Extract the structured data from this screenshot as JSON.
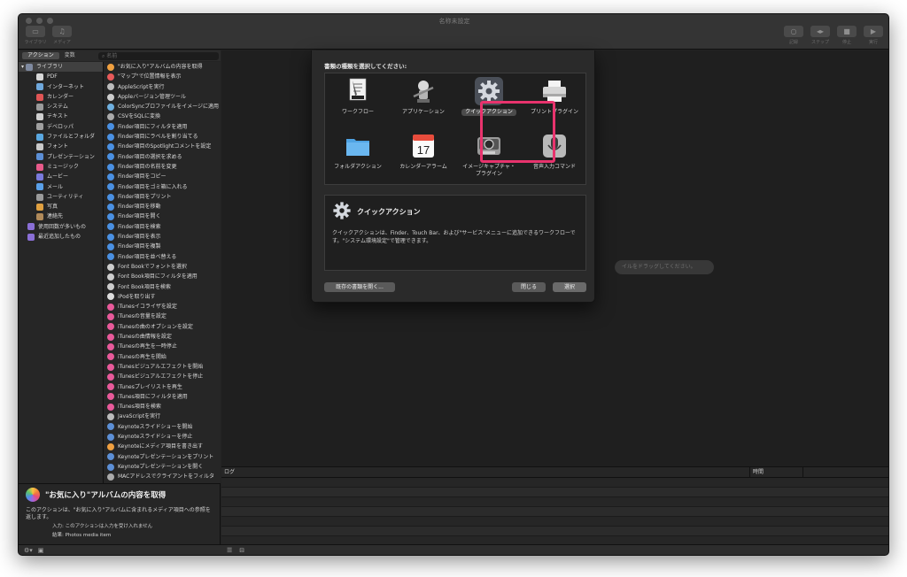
{
  "window": {
    "title": "名称未設定"
  },
  "toolbar": {
    "left_buttons": [
      {
        "label": "ライブラリ"
      },
      {
        "label": "メディア"
      }
    ],
    "right_buttons": [
      {
        "label": "記録"
      },
      {
        "label": "ステップ"
      },
      {
        "label": "停止"
      },
      {
        "label": "実行"
      }
    ]
  },
  "tabs": [
    {
      "label": "アクション"
    },
    {
      "label": "変数"
    }
  ],
  "search": {
    "placeholder": "名前"
  },
  "library": [
    {
      "label": "ライブラリ",
      "color": "#7f8aa0"
    },
    {
      "label": "PDF",
      "color": "#d7d7d7"
    },
    {
      "label": "インターネット",
      "color": "#6fa8dc"
    },
    {
      "label": "カレンダー",
      "color": "#e05555"
    },
    {
      "label": "システム",
      "color": "#9a9a9a"
    },
    {
      "label": "テキスト",
      "color": "#d0d0d0"
    },
    {
      "label": "デベロッパ",
      "color": "#a0a0a0"
    },
    {
      "label": "ファイルとフォルダ",
      "color": "#5aa7e0"
    },
    {
      "label": "フォント",
      "color": "#c9c9c9"
    },
    {
      "label": "プレゼンテーション",
      "color": "#5c8fd6"
    },
    {
      "label": "ミュージック",
      "color": "#e85a8a"
    },
    {
      "label": "ムービー",
      "color": "#7a7adc"
    },
    {
      "label": "メール",
      "color": "#5aa0e8"
    },
    {
      "label": "ユーティリティ",
      "color": "#9a9a9a"
    },
    {
      "label": "写真",
      "color": "#e0a040"
    },
    {
      "label": "連絡先",
      "color": "#b08a5a"
    },
    {
      "label": "使用回数が多いもの",
      "color": "#8a6fd6"
    },
    {
      "label": "最近追加したもの",
      "color": "#8a6fd6"
    }
  ],
  "actions": [
    {
      "label": "\"お気に入り\"アルバムの内容を取得",
      "color": "#f0a040"
    },
    {
      "label": "\"マップ\"で位置情報を表示",
      "color": "#e85a5a"
    },
    {
      "label": "AppleScriptを実行",
      "color": "#bbbbbb"
    },
    {
      "label": "Appleバージョン管理ツール",
      "color": "#cccccc"
    },
    {
      "label": "ColorSyncプロファイルをイメージに適用",
      "color": "#6fb0e0"
    },
    {
      "label": "CSVをSQLに変換",
      "color": "#aaaaaa"
    },
    {
      "label": "Finder項目にフィルタを適用",
      "color": "#4a90e2"
    },
    {
      "label": "Finder項目にラベルを割り当てる",
      "color": "#4a90e2"
    },
    {
      "label": "Finder項目のSpotlightコメントを設定",
      "color": "#4a90e2"
    },
    {
      "label": "Finder項目の選択を求める",
      "color": "#4a90e2"
    },
    {
      "label": "Finder項目の名前を変更",
      "color": "#4a90e2"
    },
    {
      "label": "Finder項目をコピー",
      "color": "#4a90e2"
    },
    {
      "label": "Finder項目をゴミ箱に入れる",
      "color": "#4a90e2"
    },
    {
      "label": "Finder項目をプリント",
      "color": "#4a90e2"
    },
    {
      "label": "Finder項目を移動",
      "color": "#4a90e2"
    },
    {
      "label": "Finder項目を開く",
      "color": "#4a90e2"
    },
    {
      "label": "Finder項目を検索",
      "color": "#4a90e2"
    },
    {
      "label": "Finder項目を表示",
      "color": "#4a90e2"
    },
    {
      "label": "Finder項目を複製",
      "color": "#4a90e2"
    },
    {
      "label": "Finder項目を並べ替える",
      "color": "#4a90e2"
    },
    {
      "label": "Font Bookでフォントを選択",
      "color": "#cccccc"
    },
    {
      "label": "Font Book項目にフィルタを適用",
      "color": "#cccccc"
    },
    {
      "label": "Font Book項目を検索",
      "color": "#cccccc"
    },
    {
      "label": "iPodを取り出す",
      "color": "#dddddd"
    },
    {
      "label": "iTunesイコライザを設定",
      "color": "#e85a9a"
    },
    {
      "label": "iTunesの音量を設定",
      "color": "#e85a9a"
    },
    {
      "label": "iTunesの曲のオプションを設定",
      "color": "#e85a9a"
    },
    {
      "label": "iTunesの曲情報を設定",
      "color": "#e85a9a"
    },
    {
      "label": "iTunesの再生を一時停止",
      "color": "#e85a9a"
    },
    {
      "label": "iTunesの再生を開始",
      "color": "#e85a9a"
    },
    {
      "label": "iTunesビジュアルエフェクトを開始",
      "color": "#e85a9a"
    },
    {
      "label": "iTunesビジュアルエフェクトを停止",
      "color": "#e85a9a"
    },
    {
      "label": "iTunesプレイリストを再生",
      "color": "#e85a9a"
    },
    {
      "label": "iTunes項目にフィルタを適用",
      "color": "#e85a9a"
    },
    {
      "label": "iTunes項目を検索",
      "color": "#e85a9a"
    },
    {
      "label": "JavaScriptを実行",
      "color": "#bbbbbb"
    },
    {
      "label": "Keynoteスライドショーを開始",
      "color": "#5c8fd6"
    },
    {
      "label": "Keynoteスライドショーを停止",
      "color": "#5c8fd6"
    },
    {
      "label": "Keynoteにメディア項目を書き出す",
      "color": "#f0a040"
    },
    {
      "label": "Keynoteプレゼンテーションをプリント",
      "color": "#5c8fd6"
    },
    {
      "label": "Keynoteプレゼンテーションを開く",
      "color": "#5c8fd6"
    },
    {
      "label": "MACアドレスでクライアントをフィルタ",
      "color": "#aaaaaa"
    }
  ],
  "description": {
    "title": "\"お気に入り\"アルバムの内容を取得",
    "body": "このアクションは、\"お気に入り\"アルバムに含まれるメディア項目への参照を返します。",
    "input": "入力: このアクションは入力を受け入れません",
    "result": "結果: Photos media item"
  },
  "workflow_placeholder": "イルをドラッグしてください。",
  "log": {
    "col_log": "ログ",
    "col_time": "時間"
  },
  "dialog": {
    "prompt": "書類の種類を選択してください:",
    "types": [
      {
        "label": "ワークフロー",
        "icon": "workflow-icon"
      },
      {
        "label": "アプリケーション",
        "icon": "application-icon"
      },
      {
        "label": "クイックアクション",
        "icon": "gear-icon",
        "selected": true
      },
      {
        "label": "プリントプラグイン",
        "icon": "printer-icon"
      },
      {
        "label": "フォルダアクション",
        "icon": "folder-icon"
      },
      {
        "label": "カレンダーアラーム",
        "icon": "calendar-icon",
        "day": "17"
      },
      {
        "label": "イメージキャプチャ・プラグイン",
        "icon": "camera-icon"
      },
      {
        "label": "音声入力コマンド",
        "icon": "microphone-icon"
      }
    ],
    "info": {
      "title": "クイックアクション",
      "body": "クイックアクションは、Finder、Touch Bar、および\"サービス\"メニューに追加できるワークフローです。\"システム環境設定\"で管理できます。"
    },
    "open_existing": "既存の書類を開く...",
    "close": "閉じる",
    "choose": "選択"
  }
}
